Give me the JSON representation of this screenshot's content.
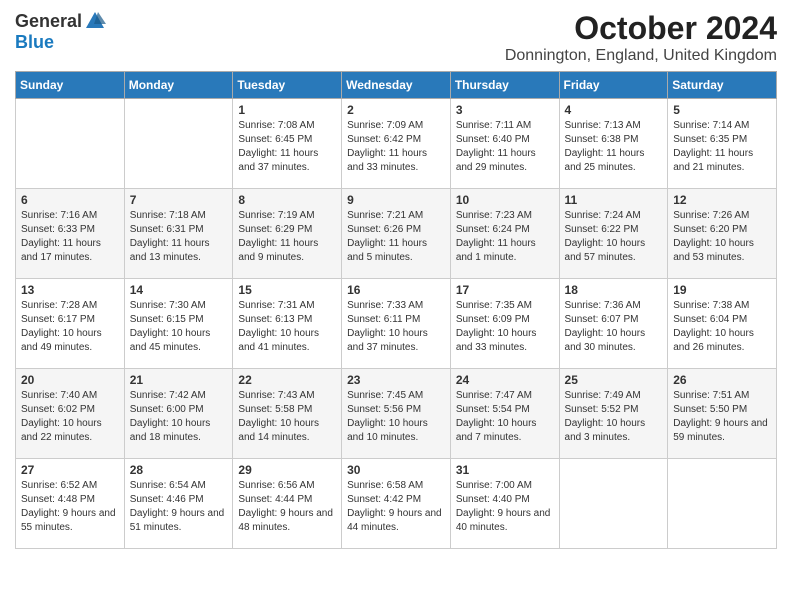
{
  "header": {
    "logo_general": "General",
    "logo_blue": "Blue",
    "month_title": "October 2024",
    "location": "Donnington, England, United Kingdom"
  },
  "weekdays": [
    "Sunday",
    "Monday",
    "Tuesday",
    "Wednesday",
    "Thursday",
    "Friday",
    "Saturday"
  ],
  "weeks": [
    [
      {
        "day": "",
        "info": ""
      },
      {
        "day": "",
        "info": ""
      },
      {
        "day": "1",
        "info": "Sunrise: 7:08 AM\nSunset: 6:45 PM\nDaylight: 11 hours and 37 minutes."
      },
      {
        "day": "2",
        "info": "Sunrise: 7:09 AM\nSunset: 6:42 PM\nDaylight: 11 hours and 33 minutes."
      },
      {
        "day": "3",
        "info": "Sunrise: 7:11 AM\nSunset: 6:40 PM\nDaylight: 11 hours and 29 minutes."
      },
      {
        "day": "4",
        "info": "Sunrise: 7:13 AM\nSunset: 6:38 PM\nDaylight: 11 hours and 25 minutes."
      },
      {
        "day": "5",
        "info": "Sunrise: 7:14 AM\nSunset: 6:35 PM\nDaylight: 11 hours and 21 minutes."
      }
    ],
    [
      {
        "day": "6",
        "info": "Sunrise: 7:16 AM\nSunset: 6:33 PM\nDaylight: 11 hours and 17 minutes."
      },
      {
        "day": "7",
        "info": "Sunrise: 7:18 AM\nSunset: 6:31 PM\nDaylight: 11 hours and 13 minutes."
      },
      {
        "day": "8",
        "info": "Sunrise: 7:19 AM\nSunset: 6:29 PM\nDaylight: 11 hours and 9 minutes."
      },
      {
        "day": "9",
        "info": "Sunrise: 7:21 AM\nSunset: 6:26 PM\nDaylight: 11 hours and 5 minutes."
      },
      {
        "day": "10",
        "info": "Sunrise: 7:23 AM\nSunset: 6:24 PM\nDaylight: 11 hours and 1 minute."
      },
      {
        "day": "11",
        "info": "Sunrise: 7:24 AM\nSunset: 6:22 PM\nDaylight: 10 hours and 57 minutes."
      },
      {
        "day": "12",
        "info": "Sunrise: 7:26 AM\nSunset: 6:20 PM\nDaylight: 10 hours and 53 minutes."
      }
    ],
    [
      {
        "day": "13",
        "info": "Sunrise: 7:28 AM\nSunset: 6:17 PM\nDaylight: 10 hours and 49 minutes."
      },
      {
        "day": "14",
        "info": "Sunrise: 7:30 AM\nSunset: 6:15 PM\nDaylight: 10 hours and 45 minutes."
      },
      {
        "day": "15",
        "info": "Sunrise: 7:31 AM\nSunset: 6:13 PM\nDaylight: 10 hours and 41 minutes."
      },
      {
        "day": "16",
        "info": "Sunrise: 7:33 AM\nSunset: 6:11 PM\nDaylight: 10 hours and 37 minutes."
      },
      {
        "day": "17",
        "info": "Sunrise: 7:35 AM\nSunset: 6:09 PM\nDaylight: 10 hours and 33 minutes."
      },
      {
        "day": "18",
        "info": "Sunrise: 7:36 AM\nSunset: 6:07 PM\nDaylight: 10 hours and 30 minutes."
      },
      {
        "day": "19",
        "info": "Sunrise: 7:38 AM\nSunset: 6:04 PM\nDaylight: 10 hours and 26 minutes."
      }
    ],
    [
      {
        "day": "20",
        "info": "Sunrise: 7:40 AM\nSunset: 6:02 PM\nDaylight: 10 hours and 22 minutes."
      },
      {
        "day": "21",
        "info": "Sunrise: 7:42 AM\nSunset: 6:00 PM\nDaylight: 10 hours and 18 minutes."
      },
      {
        "day": "22",
        "info": "Sunrise: 7:43 AM\nSunset: 5:58 PM\nDaylight: 10 hours and 14 minutes."
      },
      {
        "day": "23",
        "info": "Sunrise: 7:45 AM\nSunset: 5:56 PM\nDaylight: 10 hours and 10 minutes."
      },
      {
        "day": "24",
        "info": "Sunrise: 7:47 AM\nSunset: 5:54 PM\nDaylight: 10 hours and 7 minutes."
      },
      {
        "day": "25",
        "info": "Sunrise: 7:49 AM\nSunset: 5:52 PM\nDaylight: 10 hours and 3 minutes."
      },
      {
        "day": "26",
        "info": "Sunrise: 7:51 AM\nSunset: 5:50 PM\nDaylight: 9 hours and 59 minutes."
      }
    ],
    [
      {
        "day": "27",
        "info": "Sunrise: 6:52 AM\nSunset: 4:48 PM\nDaylight: 9 hours and 55 minutes."
      },
      {
        "day": "28",
        "info": "Sunrise: 6:54 AM\nSunset: 4:46 PM\nDaylight: 9 hours and 51 minutes."
      },
      {
        "day": "29",
        "info": "Sunrise: 6:56 AM\nSunset: 4:44 PM\nDaylight: 9 hours and 48 minutes."
      },
      {
        "day": "30",
        "info": "Sunrise: 6:58 AM\nSunset: 4:42 PM\nDaylight: 9 hours and 44 minutes."
      },
      {
        "day": "31",
        "info": "Sunrise: 7:00 AM\nSunset: 4:40 PM\nDaylight: 9 hours and 40 minutes."
      },
      {
        "day": "",
        "info": ""
      },
      {
        "day": "",
        "info": ""
      }
    ]
  ]
}
